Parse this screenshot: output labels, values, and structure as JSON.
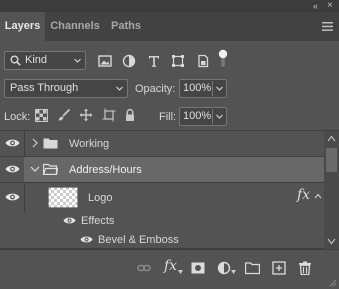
{
  "tabs": [
    {
      "label": "Layers",
      "active": true
    },
    {
      "label": "Channels",
      "active": false
    },
    {
      "label": "Paths",
      "active": false
    }
  ],
  "titlebar": {
    "collapse_glyph": "«",
    "close_glyph": "×"
  },
  "filter": {
    "kind_label": "Kind",
    "icons": [
      "image-filter-icon",
      "adjustment-filter-icon",
      "type-filter-icon",
      "shape-filter-icon",
      "smart-object-filter-icon",
      "filter-toggle-icon"
    ]
  },
  "blend": {
    "mode": "Pass Through",
    "opacity_label": "Opacity:",
    "opacity_value": "100%"
  },
  "lock": {
    "label": "Lock:",
    "fill_label": "Fill:",
    "fill_value": "100%"
  },
  "layers": [
    {
      "name": "Working",
      "type": "group",
      "expanded": false,
      "selected": false
    },
    {
      "name": "Address/Hours",
      "type": "group",
      "expanded": true,
      "selected": true
    },
    {
      "name": "Logo",
      "type": "layer",
      "fx": "fx",
      "selected": false
    },
    {
      "name": "Effects",
      "type": "effects",
      "selected": false
    },
    {
      "name": "Bevel & Emboss",
      "type": "effect",
      "selected": false
    }
  ],
  "bottom_fx": "fx",
  "colors": {
    "panel": "#535353",
    "selected_row": "#686868",
    "tabbar": "#424242"
  }
}
